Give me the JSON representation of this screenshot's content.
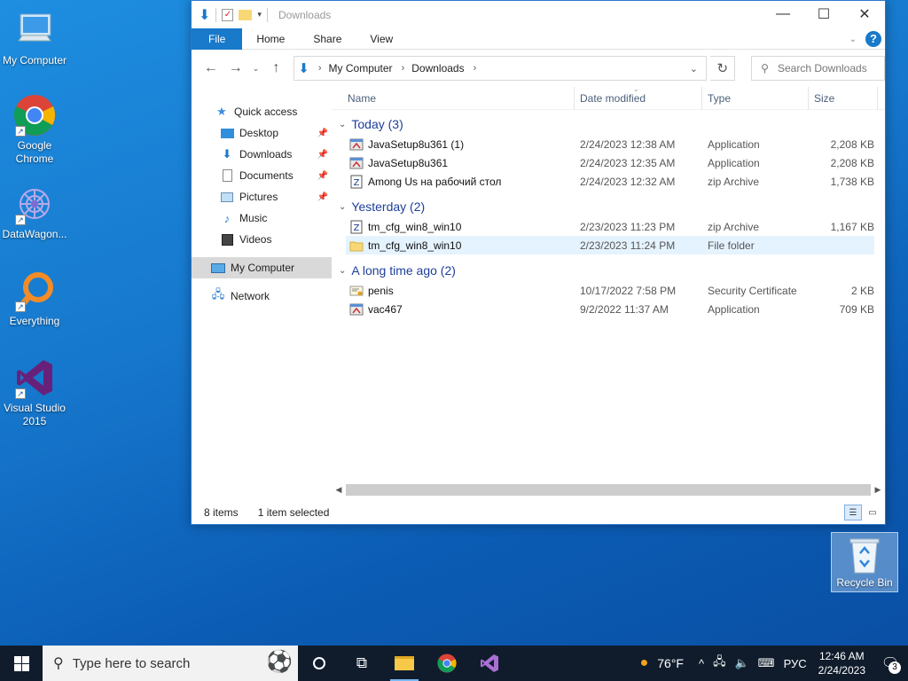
{
  "desktop": {
    "icons": [
      {
        "label": "My Computer"
      },
      {
        "label": "Google Chrome"
      },
      {
        "label": "DataWagon..."
      },
      {
        "label": "Everything"
      },
      {
        "label": "Visual Studio 2015"
      }
    ],
    "recycle_bin": "Recycle Bin"
  },
  "window": {
    "title": "Downloads",
    "tabs": [
      "File",
      "Home",
      "Share",
      "View"
    ],
    "address": {
      "crumbs": [
        "My Computer",
        "Downloads"
      ]
    },
    "search_placeholder": "Search Downloads",
    "nav": {
      "quick_access": "Quick access",
      "items": [
        "Desktop",
        "Downloads",
        "Documents",
        "Pictures",
        "Music",
        "Videos"
      ],
      "my_computer": "My Computer",
      "network": "Network"
    },
    "columns": {
      "name": "Name",
      "date": "Date modified",
      "type": "Type",
      "size": "Size"
    },
    "groups": [
      {
        "label": "Today (3)",
        "rows": [
          {
            "name": "JavaSetup8u361 (1)",
            "date": "2/24/2023 12:38 AM",
            "type": "Application",
            "size": "2,208 KB",
            "icon": "app-icon"
          },
          {
            "name": "JavaSetup8u361",
            "date": "2/24/2023 12:35 AM",
            "type": "Application",
            "size": "2,208 KB",
            "icon": "app-icon"
          },
          {
            "name": "Among Us на рабочий стол",
            "date": "2/24/2023 12:32 AM",
            "type": "zip Archive",
            "size": "1,738 KB",
            "icon": "zip-icon"
          }
        ]
      },
      {
        "label": "Yesterday (2)",
        "rows": [
          {
            "name": "tm_cfg_win8_win10",
            "date": "2/23/2023 11:23 PM",
            "type": "zip Archive",
            "size": "1,167 KB",
            "icon": "zip-icon"
          },
          {
            "name": "tm_cfg_win8_win10",
            "date": "2/23/2023 11:24 PM",
            "type": "File folder",
            "size": "",
            "icon": "folder-icon"
          }
        ]
      },
      {
        "label": "A long time ago (2)",
        "rows": [
          {
            "name": "penis",
            "date": "10/17/2022 7:58 PM",
            "type": "Security Certificate",
            "size": "2 KB",
            "icon": "certificate-icon"
          },
          {
            "name": "vac467",
            "date": "9/2/2022 11:37 AM",
            "type": "Application",
            "size": "709 KB",
            "icon": "app-icon"
          }
        ]
      }
    ],
    "status": {
      "items": "8 items",
      "selected": "1 item selected"
    }
  },
  "taskbar": {
    "search_placeholder": "Type here to search",
    "weather": "76°F",
    "language": "РУС",
    "time": "12:46 AM",
    "date": "2/24/2023",
    "notifications": "3"
  }
}
